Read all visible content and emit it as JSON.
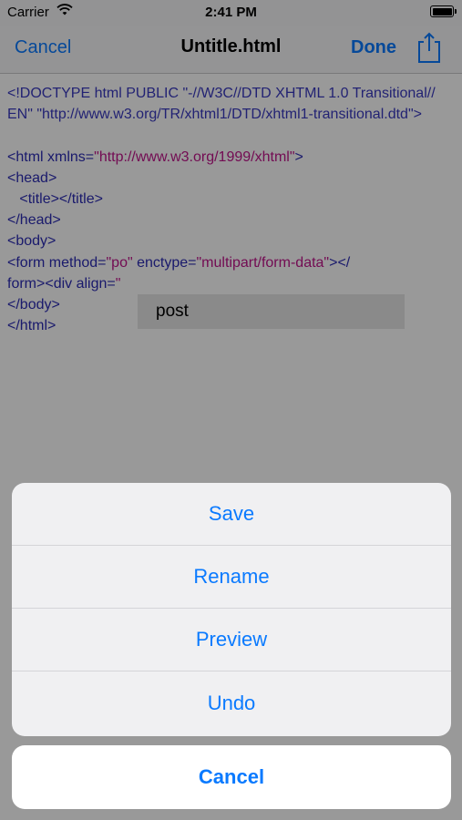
{
  "status_bar": {
    "carrier": "Carrier",
    "time": "2:41 PM"
  },
  "nav": {
    "cancel_label": "Cancel",
    "title": "Untitle.html",
    "done_label": "Done",
    "share_icon": "share-icon"
  },
  "editor": {
    "doctype": "<!DOCTYPE html PUBLIC \"-//W3C//DTD XHTML 1.0 Transitional//EN\" \"http://www.w3.org/TR/xhtml1/DTD/xhtml1-transitional.dtd\">",
    "line_html_open": "<html",
    "line_html_attr": " xmlns=",
    "line_html_val": "\"http://www.w3.org/1999/xhtml\"",
    "line_html_close": ">",
    "line_head_open": "<head>",
    "line_title_indent": "   ",
    "line_title": "<title></title>",
    "line_head_close": "</head>",
    "line_body_open": "<body>",
    "line_form_tag": "<form",
    "line_form_method": " method=",
    "line_form_method_val": "\"po\"",
    "line_form_enctype": " enctype=",
    "line_form_enctype_val": "\"multipart/form-data\"",
    "line_form_end": "></",
    "line_form_close": "form><div align=",
    "line_form_trunc": "\"",
    "line_body_close": "</body>",
    "line_html_close_tag": "</html>",
    "autocomplete_suggestion": "post"
  },
  "action_sheet": {
    "items": [
      "Save",
      "Rename",
      "Preview",
      "Undo"
    ],
    "cancel_label": "Cancel"
  },
  "colors": {
    "accent": "#0a7aff",
    "tag": "#2c2cb5",
    "string": "#c0148a"
  }
}
